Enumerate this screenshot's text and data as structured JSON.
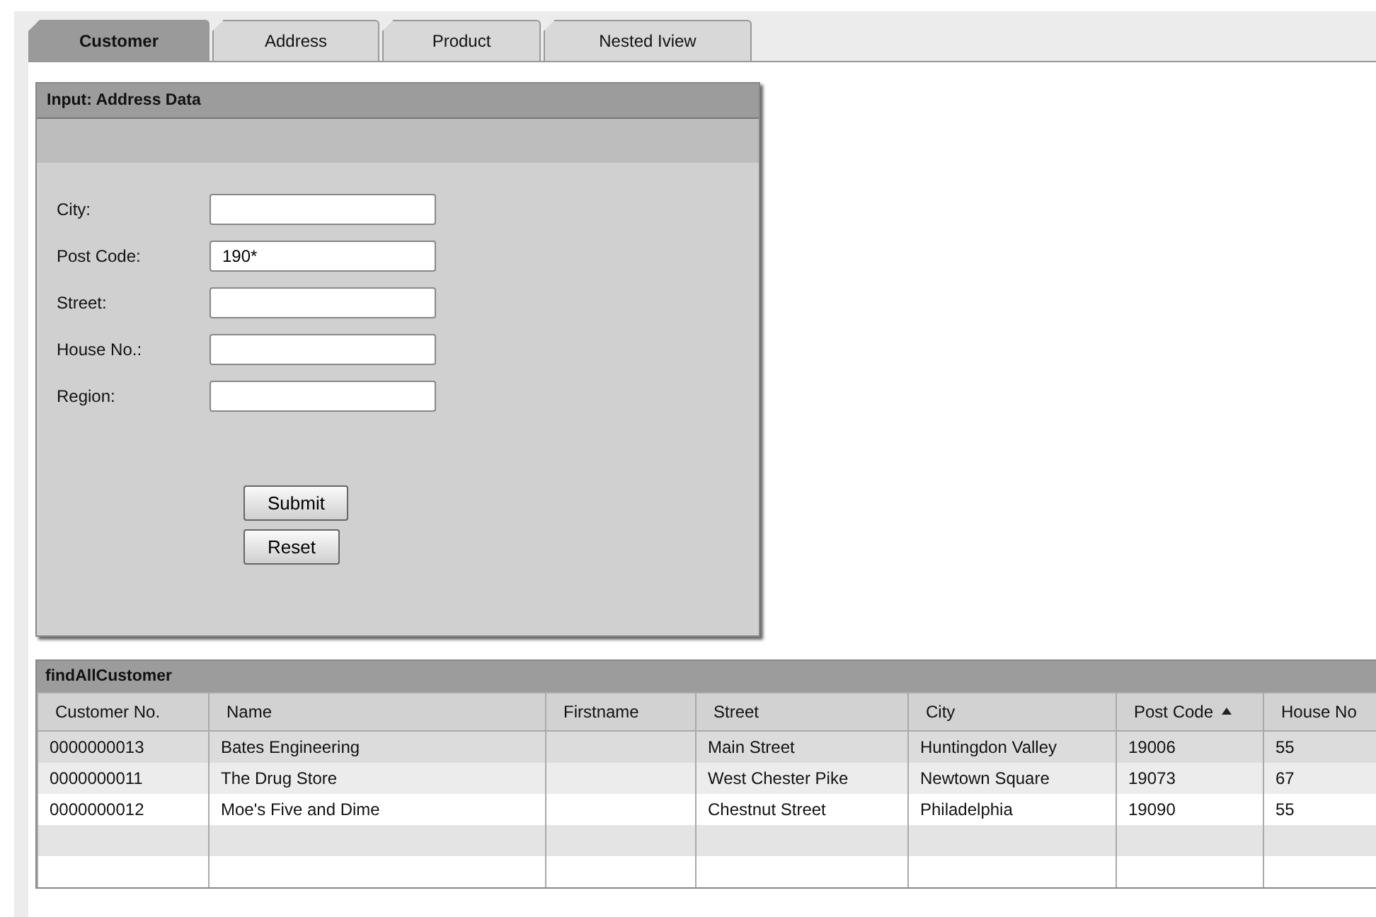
{
  "tabs": [
    {
      "label": "Customer",
      "selected": true
    },
    {
      "label": "Address",
      "selected": false
    },
    {
      "label": "Product",
      "selected": false
    },
    {
      "label": "Nested Iview",
      "selected": false
    }
  ],
  "input_panel": {
    "title": "Input: Address Data",
    "fields": [
      {
        "label": "City:"
      },
      {
        "label": "Post Code:",
        "value": "190*"
      },
      {
        "label": "Street:"
      },
      {
        "label": "House No.:"
      },
      {
        "label": "Region:"
      }
    ],
    "buttons": [
      "Submit",
      "Reset"
    ]
  },
  "table": {
    "title": "findAllCustomer",
    "columns": [
      {
        "label": "Customer No.",
        "sorted": false
      },
      {
        "label": "Name",
        "sorted": false
      },
      {
        "label": "Firstname",
        "sorted": false
      },
      {
        "label": "Street",
        "sorted": false
      },
      {
        "label": "City",
        "sorted": false
      },
      {
        "label": "Post Code",
        "sorted": true
      },
      {
        "label": "House No",
        "sorted": false
      }
    ],
    "rows": [
      [
        "0000000013",
        "Bates Engineering",
        "",
        "Main Street",
        "Huntingdon Valley",
        "19006",
        "55"
      ],
      [
        "0000000011",
        "The Drug Store",
        "",
        "West Chester Pike",
        "Newtown Square",
        "19073",
        "67"
      ],
      [
        "0000000012",
        "Moe's Five and Dime",
        "",
        "Chestnut Street",
        "Philadelphia",
        "19090",
        "55"
      ]
    ]
  }
}
